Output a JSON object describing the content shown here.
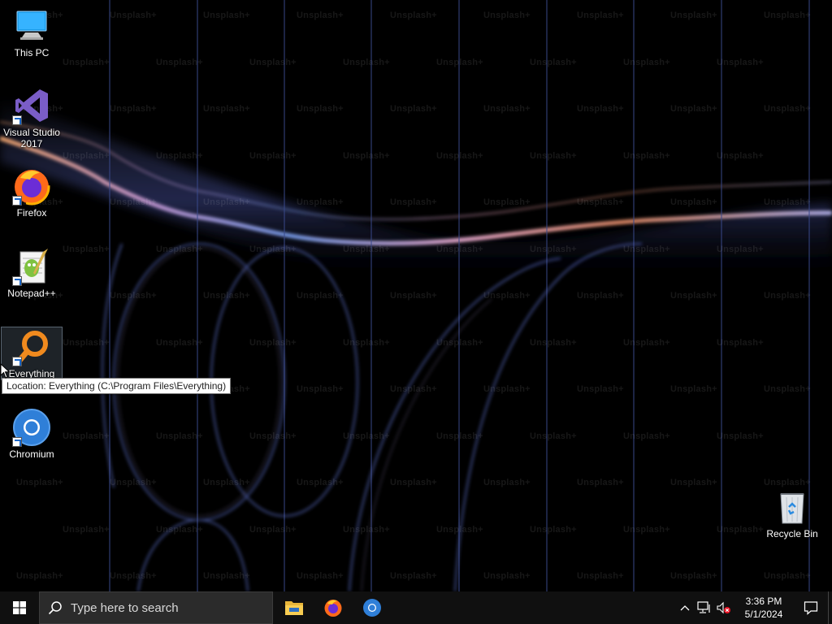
{
  "desktop": {
    "watermark_text": "Unsplash+",
    "icons": [
      {
        "label": "This PC",
        "icon": "this-pc-icon",
        "shortcut": false
      },
      {
        "label": "Visual Studio 2017",
        "icon": "visual-studio-icon",
        "shortcut": true
      },
      {
        "label": "Firefox",
        "icon": "firefox-icon",
        "shortcut": true
      },
      {
        "label": "Notepad++",
        "icon": "notepad-plus-plus-icon",
        "shortcut": true
      },
      {
        "label": "Everything",
        "icon": "everything-search-icon",
        "shortcut": true,
        "selected": true
      },
      {
        "label": "Chromium",
        "icon": "chromium-icon",
        "shortcut": true
      }
    ],
    "recycle_bin": {
      "label": "Recycle Bin",
      "icon": "recycle-bin-icon"
    },
    "tooltip": "Location: Everything (C:\\Program Files\\Everything)"
  },
  "taskbar": {
    "search_placeholder": "Type here to search",
    "pinned": [
      {
        "name": "File Explorer",
        "icon": "file-explorer-icon"
      },
      {
        "name": "Firefox",
        "icon": "firefox-icon"
      },
      {
        "name": "Chromium",
        "icon": "chromium-icon"
      }
    ],
    "tray": {
      "icons": [
        "chevron-up-icon",
        "network-icon",
        "volume-muted-icon"
      ],
      "time": "3:36 PM",
      "date": "5/1/2024"
    }
  },
  "colors": {
    "taskbar_bg": "#101010",
    "search_bg": "#2b2b2b",
    "tooltip_bg": "#ffffff",
    "windows_logo": "#ffffff",
    "accent_blue": "#76b9ed"
  }
}
